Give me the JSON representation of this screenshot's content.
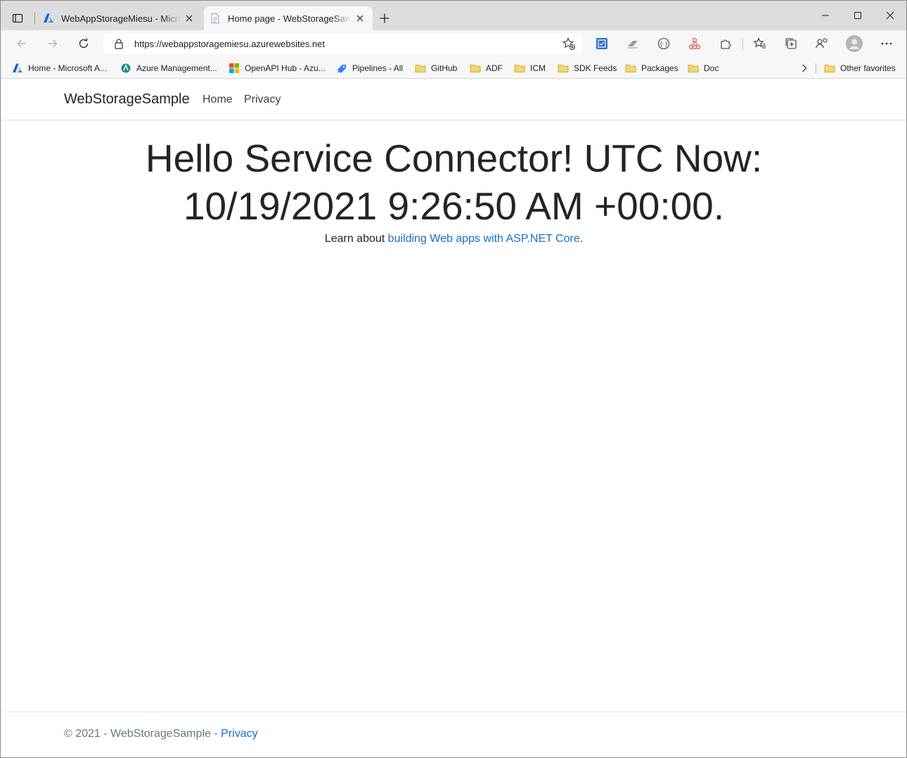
{
  "browser": {
    "tabs": [
      {
        "title": "WebAppStorageMiesu - Microsoft Azure",
        "active": false,
        "icon": "azure-logo-icon"
      },
      {
        "title": "Home page - WebStorageSample",
        "active": true,
        "icon": "page-icon"
      }
    ],
    "address": {
      "url": "https://webappstoragemiesu.azurewebsites.net"
    },
    "bookmarks": [
      {
        "label": "Home - Microsoft A...",
        "icon": "azure-logo-icon"
      },
      {
        "label": "Azure Management...",
        "icon": "azure-management-icon"
      },
      {
        "label": "OpenAPI Hub - Azu...",
        "icon": "microsoft-logo-icon"
      },
      {
        "label": "Pipelines - All",
        "icon": "pipelines-icon"
      },
      {
        "label": "GitHub",
        "icon": "folder-icon"
      },
      {
        "label": "ADF",
        "icon": "folder-icon"
      },
      {
        "label": "ICM",
        "icon": "folder-icon"
      },
      {
        "label": "SDK Feeds",
        "icon": "folder-icon"
      },
      {
        "label": "Packages",
        "icon": "folder-icon"
      },
      {
        "label": "Doc",
        "icon": "folder-icon"
      }
    ],
    "other_favorites": "Other favorites"
  },
  "site": {
    "brand": "WebStorageSample",
    "nav": [
      {
        "label": "Home"
      },
      {
        "label": "Privacy"
      }
    ],
    "heading": "Hello Service Connector! UTC Now: 10/19/2021 9:26:50 AM +00:00.",
    "learn_prefix": "Learn about ",
    "learn_link": "building Web apps with ASP.NET Core",
    "learn_suffix": ".",
    "footer_text": "© 2021 - WebStorageSample - ",
    "footer_link": "Privacy"
  },
  "colors": {
    "link": "#1b6ec2",
    "folder": "#f2c94c",
    "tab_strip": "#dcdcdc",
    "toolbar": "#f7f7f7"
  }
}
